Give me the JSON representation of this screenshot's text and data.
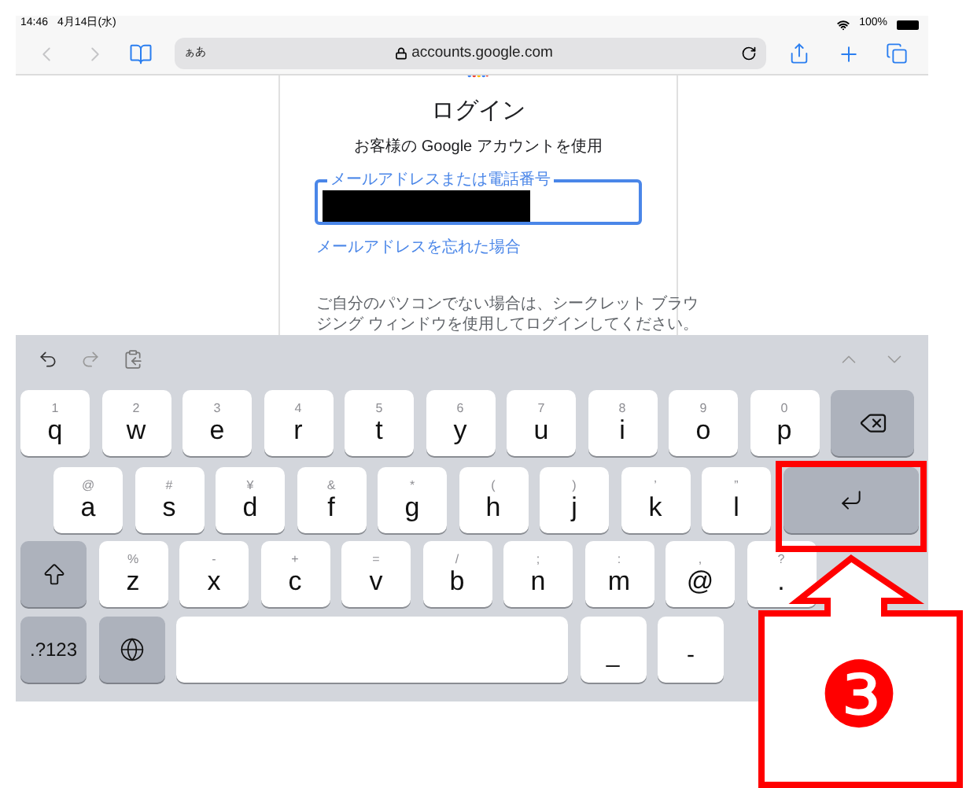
{
  "status_bar": {
    "time": "14:46",
    "date": "4月14日(水)",
    "battery": "100%"
  },
  "toolbar": {
    "text_size": "ぁあ",
    "url": "accounts.google.com"
  },
  "page": {
    "title": "ログイン",
    "subtitle": "お客様の Google アカウントを使用",
    "field": {
      "label": "メールアドレスまたは電話番号",
      "focused": true
    },
    "link": "メールアドレスを忘れた場合",
    "notice": [
      "ご自分のパソコンでない場合は、シークレット ブラウ",
      "ジング ウィンドウを使用してログインしてください。"
    ]
  },
  "keyboard": {
    "rows": [
      [
        {
          "kind": "letter",
          "label": "q",
          "alt": "1"
        },
        {
          "kind": "letter",
          "label": "w",
          "alt": "2"
        },
        {
          "kind": "letter",
          "label": "e",
          "alt": "3"
        },
        {
          "kind": "letter",
          "label": "r",
          "alt": "4"
        },
        {
          "kind": "letter",
          "label": "t",
          "alt": "5"
        },
        {
          "kind": "letter",
          "label": "y",
          "alt": "6"
        },
        {
          "kind": "letter",
          "label": "u",
          "alt": "7"
        },
        {
          "kind": "letter",
          "label": "i",
          "alt": "8"
        },
        {
          "kind": "letter",
          "label": "o",
          "alt": "9"
        },
        {
          "kind": "letter",
          "label": "p",
          "alt": "0"
        },
        {
          "kind": "delete"
        }
      ],
      [
        {
          "kind": "letter",
          "label": "a",
          "alt": "@"
        },
        {
          "kind": "letter",
          "label": "s",
          "alt": "#"
        },
        {
          "kind": "letter",
          "label": "d",
          "alt": "¥"
        },
        {
          "kind": "letter",
          "label": "f",
          "alt": "&"
        },
        {
          "kind": "letter",
          "label": "g",
          "alt": "*"
        },
        {
          "kind": "letter",
          "label": "h",
          "alt": "("
        },
        {
          "kind": "letter",
          "label": "j",
          "alt": ")"
        },
        {
          "kind": "letter",
          "label": "k",
          "alt": "’"
        },
        {
          "kind": "letter",
          "label": "l",
          "alt": "”"
        },
        {
          "kind": "return"
        }
      ],
      [
        {
          "kind": "shift"
        },
        {
          "kind": "letter",
          "label": "z",
          "alt": "%"
        },
        {
          "kind": "letter",
          "label": "x",
          "alt": "-"
        },
        {
          "kind": "letter",
          "label": "c",
          "alt": "+"
        },
        {
          "kind": "letter",
          "label": "v",
          "alt": "="
        },
        {
          "kind": "letter",
          "label": "b",
          "alt": "/"
        },
        {
          "kind": "letter",
          "label": "n",
          "alt": ";"
        },
        {
          "kind": "letter",
          "label": "m",
          "alt": ":"
        },
        {
          "kind": "letter",
          "label": "@",
          "alt": ","
        },
        {
          "kind": "letter",
          "label": ".",
          "alt": "?"
        }
      ],
      [
        {
          "kind": "numbers",
          "label": ".?123"
        },
        {
          "kind": "globe"
        },
        {
          "kind": "space"
        },
        {
          "kind": "symbol",
          "label": "_"
        },
        {
          "kind": "symbol",
          "label": "-"
        }
      ]
    ]
  },
  "callout": {
    "label": "❸"
  }
}
